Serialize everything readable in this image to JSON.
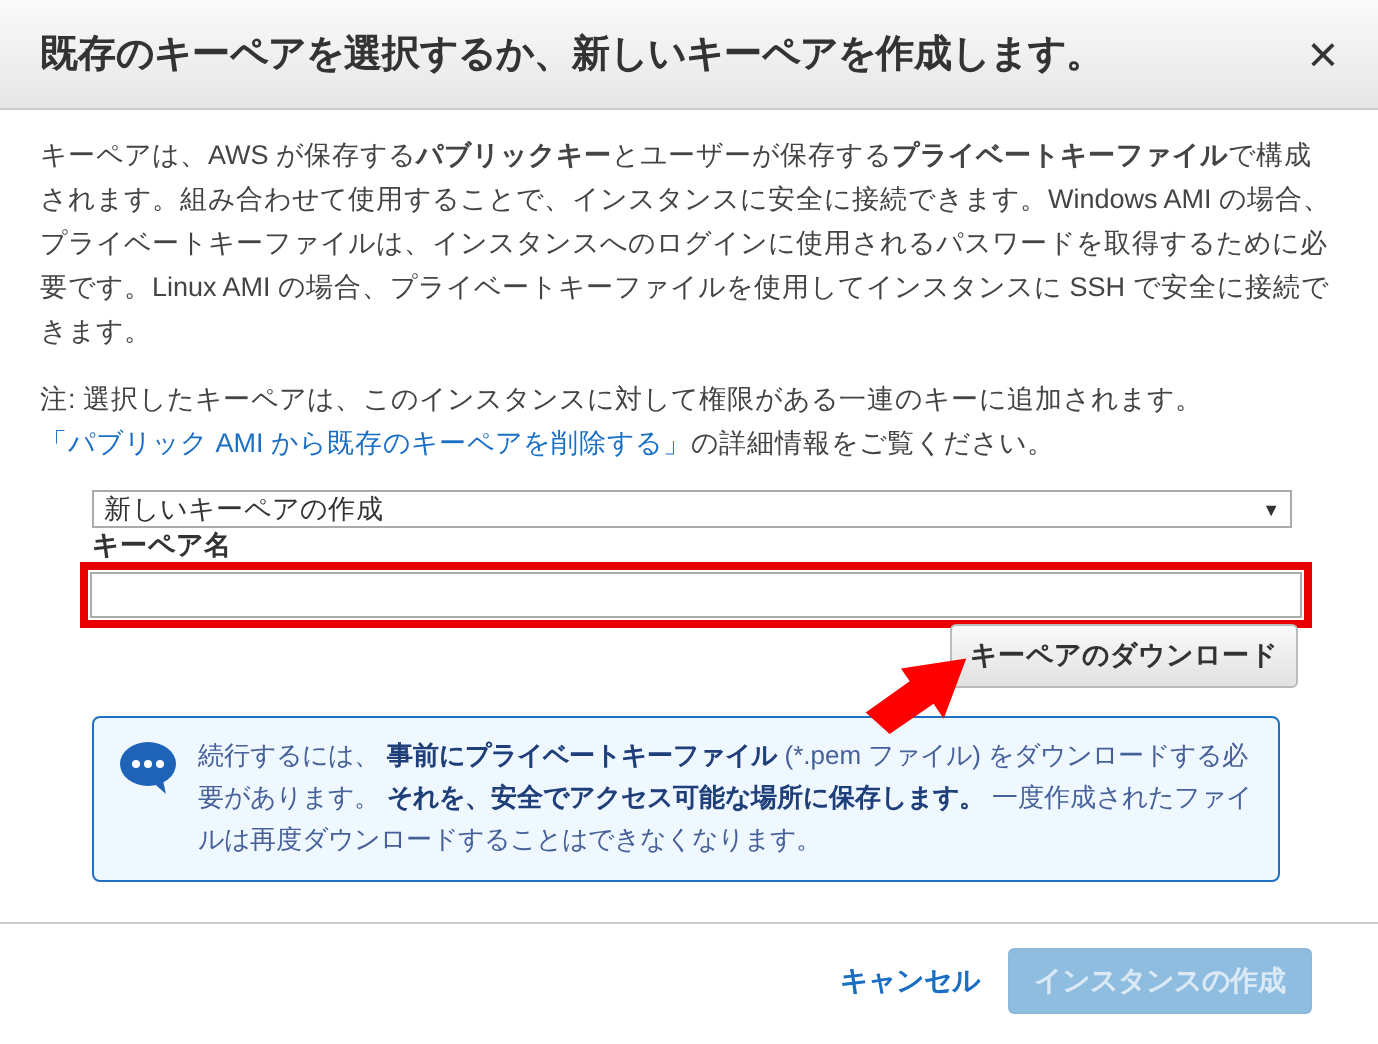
{
  "dialog": {
    "title": "既存のキーペアを選択するか、新しいキーペアを作成します。",
    "close": "×"
  },
  "description": "キーペアは、AWS が保存する**パブリックキー**とユーザーが保存する**プライベートキーファイル**で構成されます。組み合わせて使用することで、インスタンスに安全に接続できます。Windows AMI の場合、プライベートキーファイルは、インスタンスへのログインに使用されるパスワードを取得するために必要です。Linux AMI の場合、プライベートキーファイルを使用してインスタンスに SSH で安全に接続できます。",
  "note": {
    "text": "注: 選択したキーペアは、このインスタンスに対して権限がある一連のキーに追加されます。",
    "link": "「パブリック AMI から既存のキーペアを削除する」",
    "suffix": "の詳細情報をご覧ください。"
  },
  "select": {
    "value": "新しいキーペアの作成",
    "caret": "▼"
  },
  "key_name": {
    "label": "キーペア名",
    "highlighted": true
  },
  "download_button": {
    "label": "キーペアのダウンロード",
    "arrow": true
  },
  "info": "続行するには、 **事前にプライベートキーファイル** (*.pem ファイル) をダウンロードする必要があります。 **それを、安全でアクセス可能な場所に保存します。** 一度作成されたファイルは再度ダウンロードすることはできなくなります。",
  "footer": {
    "cancel": "キャンセル",
    "create": {
      "label": "インスタンスの作成",
      "disabled": true
    }
  }
}
